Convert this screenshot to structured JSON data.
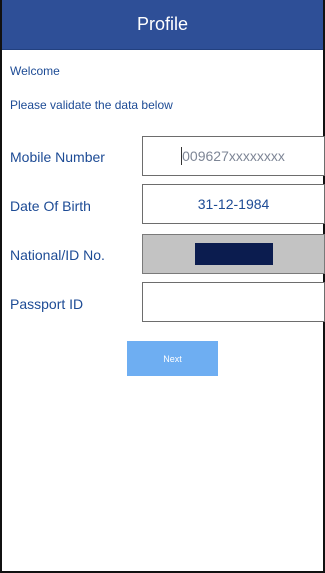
{
  "header": {
    "title": "Profile"
  },
  "intro": {
    "welcome": "Welcome",
    "instructions": "Please validate the data below"
  },
  "form": {
    "mobile": {
      "label": "Mobile Number",
      "placeholder": "009627xxxxxxxx"
    },
    "dob": {
      "label": "Date Of Birth",
      "value": "31-12-1984"
    },
    "national_id": {
      "label": "National/ID No."
    },
    "passport": {
      "label": "Passport ID",
      "value": ""
    }
  },
  "actions": {
    "next_label": "Next"
  },
  "colors": {
    "header_bg": "#2e4f97",
    "label_text": "#1d4b95",
    "button_bg": "#6eaef2",
    "disabled_field_bg": "#c3c3c3",
    "redaction": "#0b1c4f"
  }
}
